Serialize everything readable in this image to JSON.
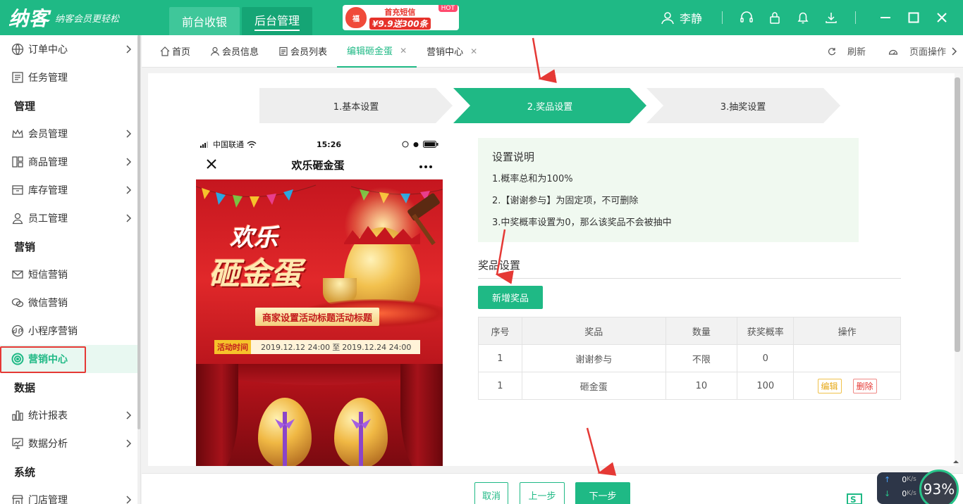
{
  "brand": {
    "logo": "纳客",
    "slogan": "纳客会员更轻松"
  },
  "top_tabs": [
    {
      "label": "前台收银",
      "active": false
    },
    {
      "label": "后台管理",
      "active": true
    }
  ],
  "promo": {
    "line1": "首充短信",
    "line2": "¥9.9送300条",
    "badge": "HOT",
    "bag": "福"
  },
  "user": {
    "name": "李静"
  },
  "sidebar": {
    "items": [
      {
        "type": "item",
        "label": "订单中心",
        "icon": "globe-icon",
        "arrow": true
      },
      {
        "type": "item",
        "label": "任务管理",
        "icon": "task-icon",
        "arrow": false
      },
      {
        "type": "group",
        "label": "管理"
      },
      {
        "type": "item",
        "label": "会员管理",
        "icon": "crown-icon",
        "arrow": true
      },
      {
        "type": "item",
        "label": "商品管理",
        "icon": "goods-icon",
        "arrow": true
      },
      {
        "type": "item",
        "label": "库存管理",
        "icon": "inventory-icon",
        "arrow": true
      },
      {
        "type": "item",
        "label": "员工管理",
        "icon": "person-icon",
        "arrow": true
      },
      {
        "type": "group",
        "label": "营销"
      },
      {
        "type": "item",
        "label": "短信营销",
        "icon": "mail-icon",
        "arrow": false
      },
      {
        "type": "item",
        "label": "微信营销",
        "icon": "wechat-icon",
        "arrow": false
      },
      {
        "type": "item",
        "label": "小程序营销",
        "icon": "miniprogram-icon",
        "arrow": false
      },
      {
        "type": "item",
        "label": "营销中心",
        "icon": "target-icon",
        "arrow": false,
        "active": true
      },
      {
        "type": "group",
        "label": "数据"
      },
      {
        "type": "item",
        "label": "统计报表",
        "icon": "bar-chart-icon",
        "arrow": true
      },
      {
        "type": "item",
        "label": "数据分析",
        "icon": "monitor-chart-icon",
        "arrow": true
      },
      {
        "type": "group",
        "label": "系统"
      },
      {
        "type": "item",
        "label": "门店管理",
        "icon": "store-icon",
        "arrow": true
      }
    ]
  },
  "page_tabs": [
    {
      "label": "首页",
      "icon": "home-icon",
      "closable": false,
      "active": false
    },
    {
      "label": "会员信息",
      "icon": "member-icon",
      "closable": false,
      "active": false
    },
    {
      "label": "会员列表",
      "icon": "list-icon",
      "closable": false,
      "active": false
    },
    {
      "label": "编辑砸金蛋",
      "icon": "",
      "closable": true,
      "active": true
    },
    {
      "label": "营销中心",
      "icon": "",
      "closable": true,
      "active": false
    }
  ],
  "page_actions": {
    "refresh": "刷新",
    "page_ops": "页面操作"
  },
  "steps": [
    {
      "label": "1.基本设置",
      "active": false
    },
    {
      "label": "2.奖品设置",
      "active": true
    },
    {
      "label": "3.抽奖设置",
      "active": false
    }
  ],
  "phone": {
    "carrier": "中国联通",
    "time": "15:26",
    "title": "欢乐砸金蛋",
    "poster_title_1": "欢乐",
    "poster_title_2": "砸金蛋",
    "banner": "商家设置活动标题活动标题",
    "time_label": "活动时间",
    "time_start": "2019.12.12 24:00",
    "time_to": "至",
    "time_end": "2019.12.24 24:00"
  },
  "instructions": {
    "heading": "设置说明",
    "lines": [
      "1.概率总和为100%",
      "2.【谢谢参与】为固定项，不可删除",
      "3.中奖概率设置为0，那么该奖品不会被抽中"
    ]
  },
  "prize_section": {
    "title": "奖品设置",
    "add_button": "新增奖品"
  },
  "prize_table": {
    "headers": [
      "序号",
      "奖品",
      "数量",
      "获奖概率",
      "操作"
    ],
    "rows": [
      {
        "no": "1",
        "prize": "谢谢参与",
        "qty": "不限",
        "prob": "0",
        "edit": "",
        "del": ""
      },
      {
        "no": "1",
        "prize": "砸金蛋",
        "qty": "10",
        "prob": "100",
        "edit": "编辑",
        "del": "删除"
      }
    ]
  },
  "bottom": {
    "cancel": "取消",
    "prev": "上一步",
    "next": "下一步"
  },
  "speed": {
    "up": "0",
    "down": "0",
    "unit": "K/s",
    "percent": "93%"
  },
  "colors": {
    "accent": "#1fb985",
    "annotation": "#e53935"
  }
}
